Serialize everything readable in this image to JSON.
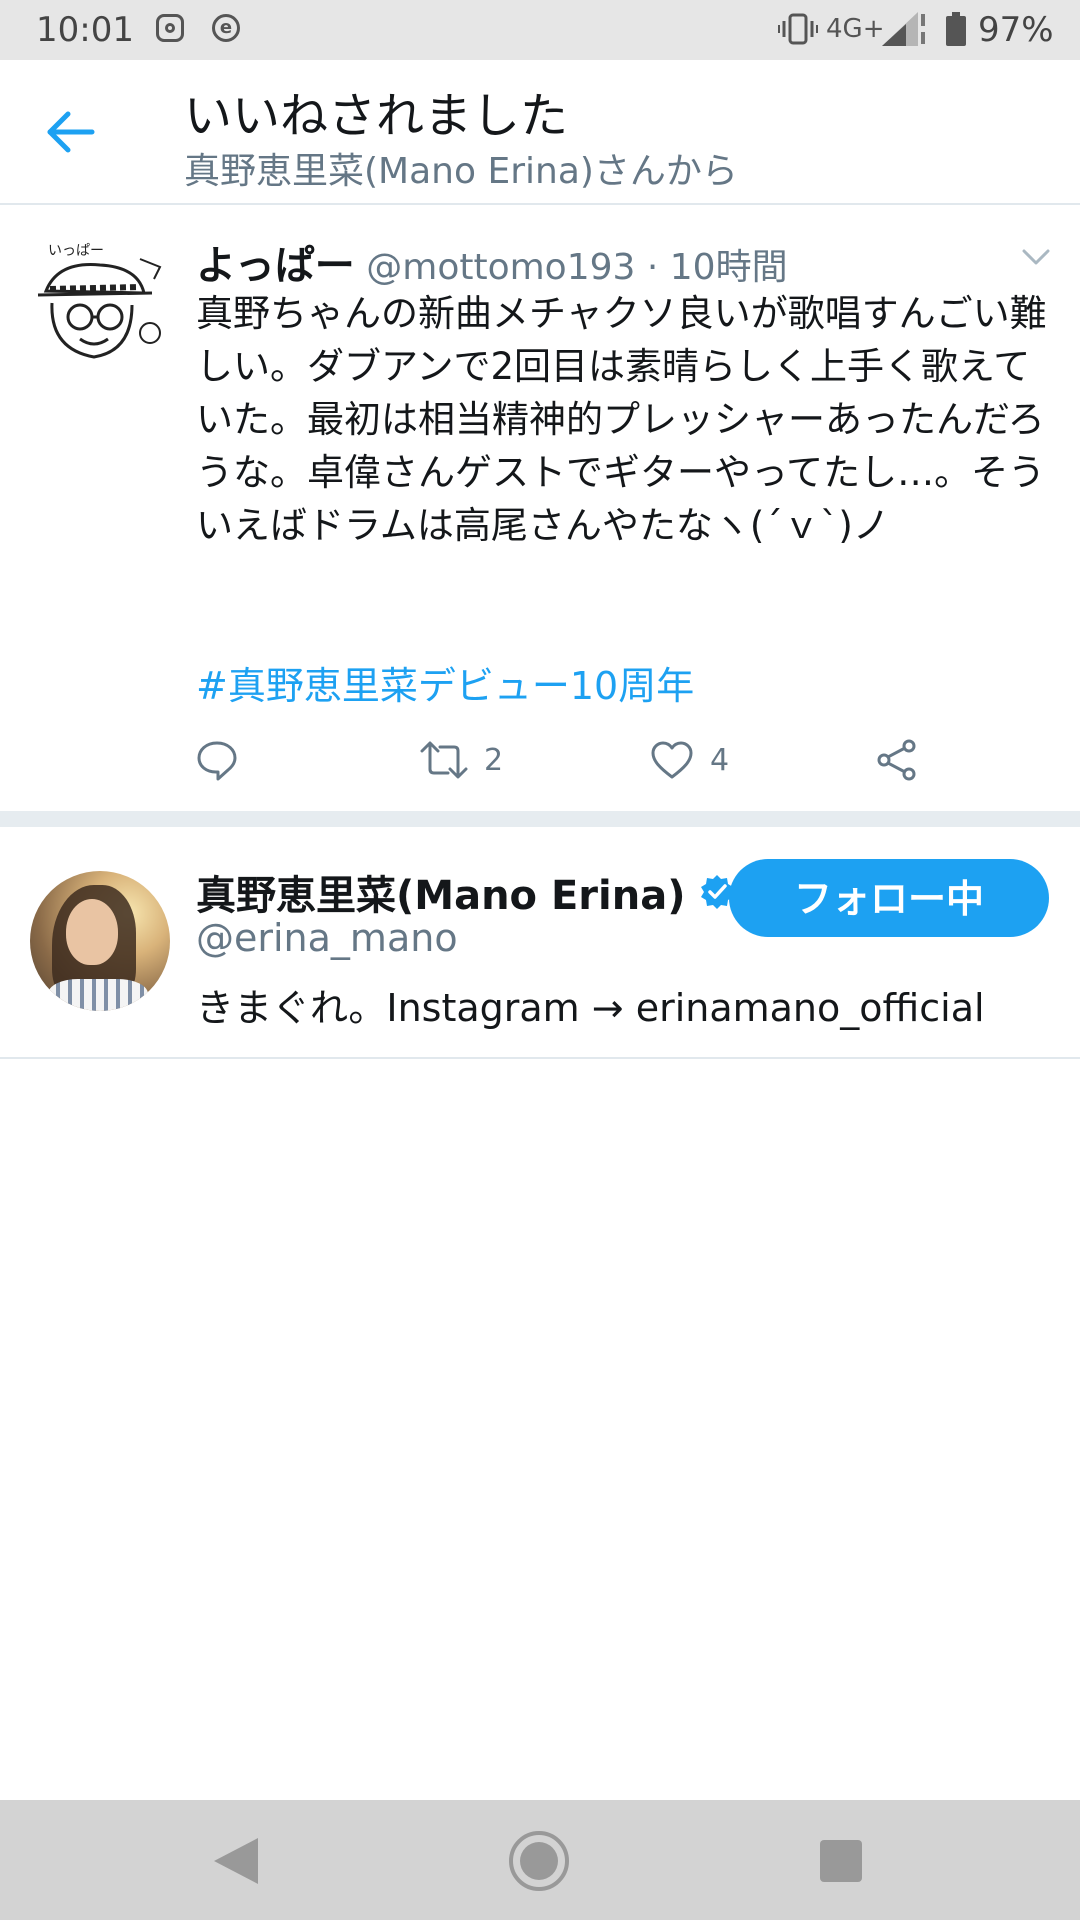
{
  "status_bar": {
    "time": "10:01",
    "network": "4G+",
    "battery": "97%",
    "icons": [
      "instagram-icon",
      "e-app-icon",
      "vibrate-icon",
      "signal-icon",
      "battery-icon"
    ]
  },
  "header": {
    "title": "いいねされました",
    "subtitle": "真野恵里菜(Mano Erina)さんから",
    "back_icon": "arrow-left-icon"
  },
  "tweet": {
    "name": "よっぱー",
    "handle": "@mottomo193",
    "separator": "·",
    "time": "10時間",
    "text": "真野ちゃんの新曲メチャクソ良いが歌唱すんごい難しい。ダブアンで2回目は素晴らしく上手く歌えていた。最初は相当精神的プレッシャーあったんだろうな。卓偉さんゲストでギターやってたし…。そういえばドラムは高尾さんやたなヽ(´ｖ`)ノ",
    "hashtag": "#真野恵里菜デビュー10周年",
    "actions": {
      "reply_count": "",
      "retweet_count": "2",
      "like_count": "4"
    }
  },
  "user_card": {
    "name": "真野恵里菜(Mano Erina)",
    "verified": true,
    "handle": "@erina_mano",
    "bio": "きまぐれ。Instagram → erinamano_official",
    "follow_label": "フォロー中"
  },
  "colors": {
    "accent": "#1da1f2",
    "secondary_text": "#657786",
    "primary_text": "#14171a",
    "status_bar_bg": "#e6e6e6",
    "nav_bar_bg": "#d3d3d3"
  }
}
